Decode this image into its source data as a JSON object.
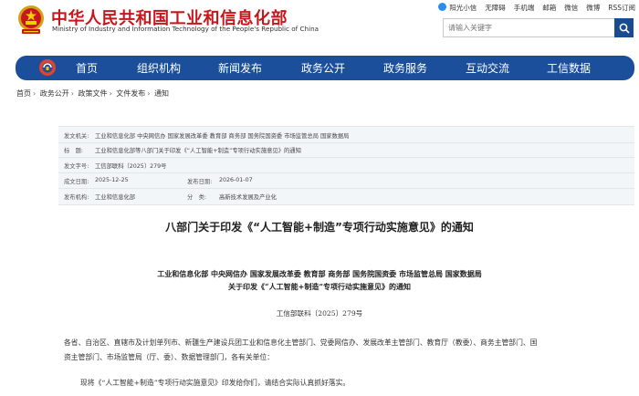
{
  "site": {
    "name_cn": "中华人民共和国工业和信息化部",
    "name_en": "Ministry of Industry and Information Technology of the People's Republic of China"
  },
  "toplinks": [
    "阳光小信",
    "无障碍",
    "手机端",
    "邮箱",
    "微信",
    "微博",
    "RSS订阅"
  ],
  "search": {
    "placeholder": "请输入关键字"
  },
  "nav": [
    "首页",
    "组织机构",
    "新闻发布",
    "政务公开",
    "政务服务",
    "互动交流",
    "工信数据"
  ],
  "breadcrumb": [
    "首页",
    "政务公开",
    "政策文件",
    "文件发布",
    "通知"
  ],
  "meta": {
    "issuer_label": "发文机关:",
    "issuer": "工业和信息化部 中央网信办 国家发展改革委 教育部 商务部 国务院国资委 市场监管总局 国家数据局",
    "title_label": "标　题:",
    "title": "工业和信息化部等八部门关于印发《“人工智能+制造”专项行动实施意见》的通知",
    "docno_label": "发文字号:",
    "docno": "工信部联科〔2025〕279号",
    "date_label": "成文日期:",
    "date": "2025-12-25",
    "pubdate_label": "发布日期:",
    "pubdate": "2026-01-07",
    "org_label": "发布机构:",
    "org": "工业和信息化部",
    "category_label": "分　类:",
    "category": "高新技术发展及产业化"
  },
  "article": {
    "title": "八部门关于印发《“人工智能+制造”专项行动实施意见》的通知",
    "recipients_line1": "工业和信息化部 中央网信办 国家发展改革委 教育部 商务部 国务院国资委 市场监管总局 国家数据局",
    "recipients_line2": "关于印发《“人工智能+制造”专项行动实施意见》的通知",
    "docno": "工信部联科〔2025〕279号",
    "body1_line1": "各省、自治区、直辖市及计划单列市、新疆生产建设兵团工业和信息化主管部门、党委网信办、发展改革主管部门、教育厅（教委）、商务主管部门、国",
    "body1_line2": "资主管部门、市场监管局（厅、委）、数据管理部门，各有关单位：",
    "body2": "现将《“人工智能+制造”专项行动实施意见》印发给你们，请结合实际认真抓好落实。"
  },
  "colors": {
    "brand_red": "#c8161d",
    "nav_blue": "#1b4f9c"
  }
}
